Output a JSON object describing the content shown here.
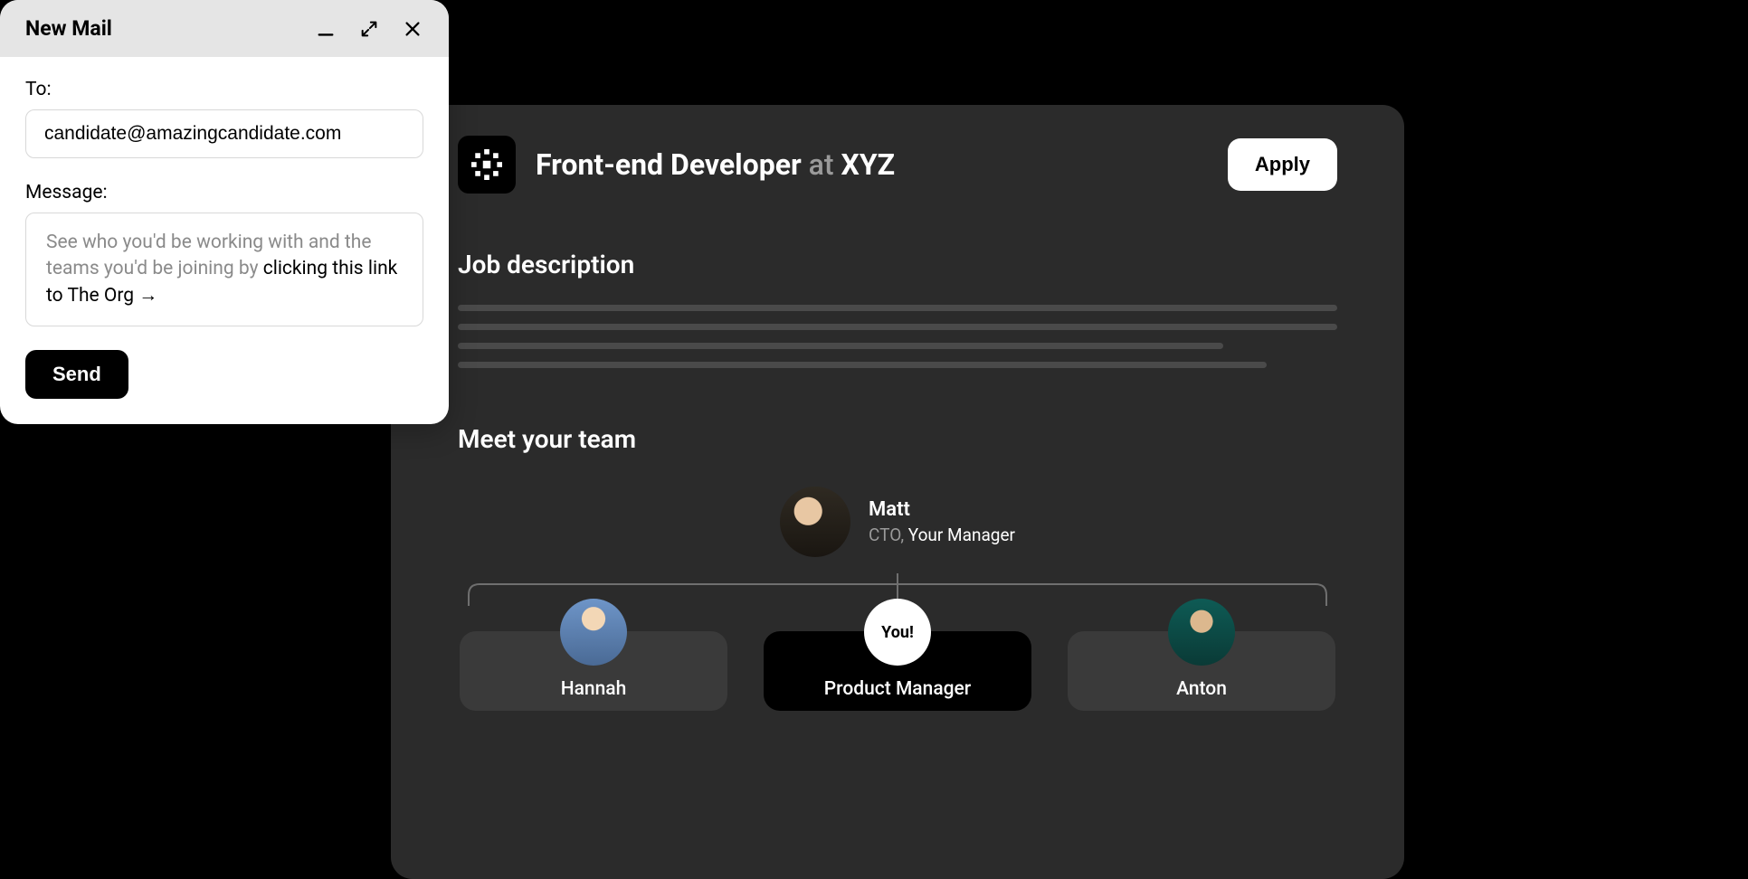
{
  "mail": {
    "title": "New Mail",
    "to_label": "To:",
    "to_value": "candidate@amazingcandidate.com",
    "message_label": "Message:",
    "message_preamble": "See who you'd be working with and the teams you'd be joining by ",
    "message_link": "clicking this link to The Org →",
    "send_label": "Send"
  },
  "job": {
    "role": "Front-end Developer",
    "at_word": "at",
    "company": "XYZ",
    "apply_label": "Apply",
    "desc_heading": "Job description",
    "team_heading": "Meet your team",
    "manager": {
      "name": "Matt",
      "title_prefix": "CTO, ",
      "title_highlight": "Your Manager"
    },
    "you_label": "You!",
    "cards": {
      "left": "Hannah",
      "center": "Product Manager",
      "right": "Anton"
    }
  }
}
